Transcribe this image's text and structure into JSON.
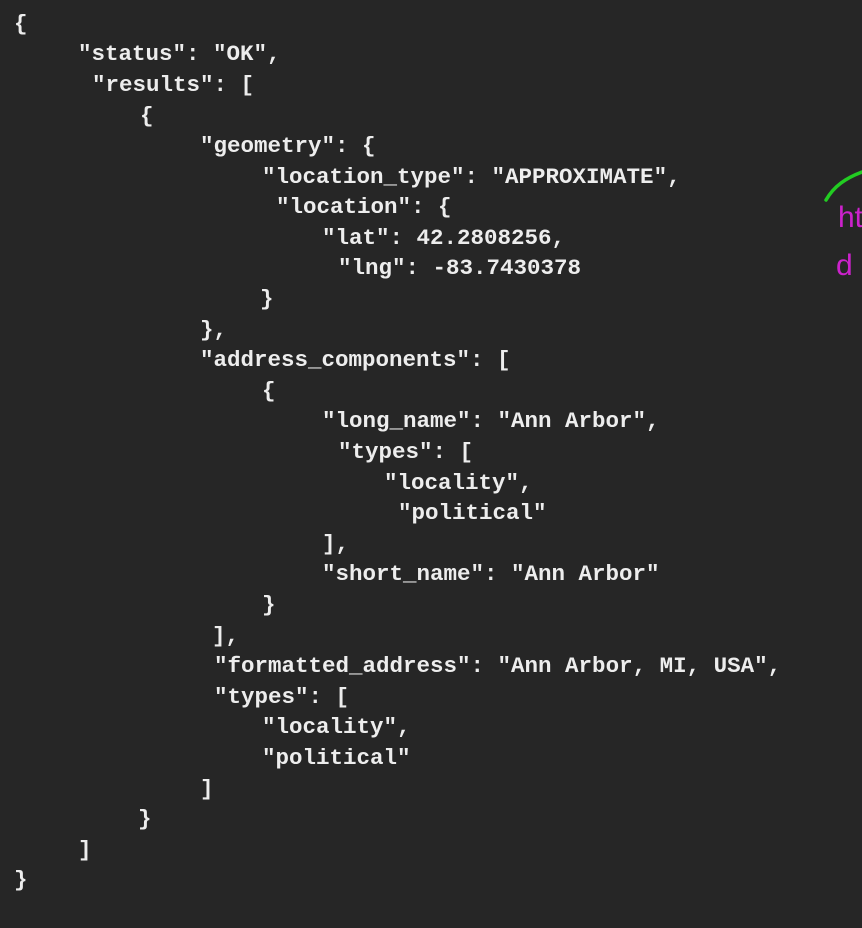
{
  "code": {
    "lines": [
      "{",
      "\"status\": \"OK\",",
      "\"results\": [",
      "{",
      "\"geometry\": {",
      "\"location_type\": \"APPROXIMATE\",",
      "\"location\": {",
      "\"lat\": 42.2808256,",
      "\"lng\": -83.7430378",
      "}",
      "},",
      "\"address_components\": [",
      "{",
      "\"long_name\": \"Ann Arbor\",",
      "\"types\": [",
      "\"locality\",",
      "\"political\"",
      "],",
      "\"short_name\": \"Ann Arbor\"",
      "}",
      "],",
      "\"formatted_address\": \"Ann Arbor, MI, USA\",",
      "\"types\": [",
      "\"locality\",",
      "\"political\"",
      "]",
      "}",
      "]",
      "}"
    ]
  },
  "annotation": {
    "line1": "ht",
    "line2": "d",
    "text_color": "#cc22cc",
    "stroke_color": "#22cc22"
  },
  "colors": {
    "background": "#262626",
    "code_text": "#ededed"
  }
}
